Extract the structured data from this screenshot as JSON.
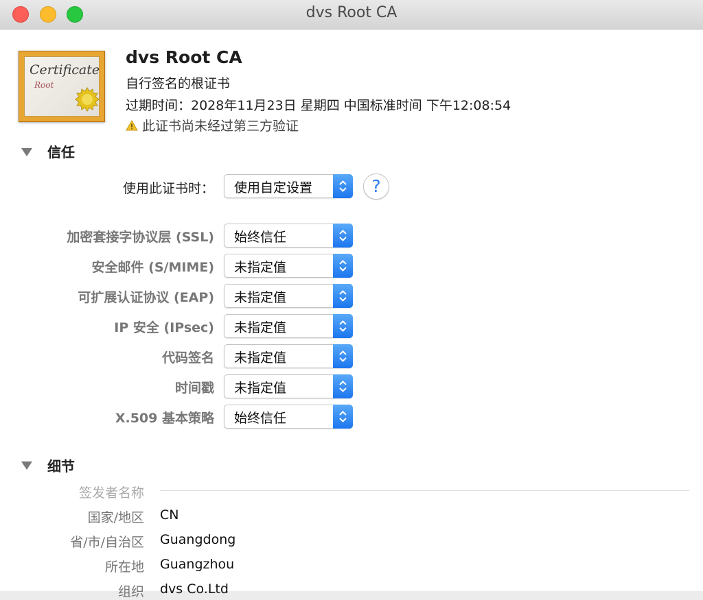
{
  "window": {
    "title": "dvs Root CA"
  },
  "certificate": {
    "icon_text": "Certificate",
    "icon_subtext": "Root",
    "name": "dvs Root CA",
    "kind": "自行签名的根证书",
    "expiry": "过期时间：2028年11月23日 星期四 中国标准时间 下午12:08:54",
    "warning": "此证书尚未经过第三方验证"
  },
  "trust": {
    "title": "信任",
    "use_label": "使用此证书时：",
    "use_value": "使用自定设置",
    "help_label": "?",
    "rows": [
      {
        "label": "加密套接字协议层 (SSL)",
        "value": "始终信任"
      },
      {
        "label": "安全邮件 (S/MIME)",
        "value": "未指定值"
      },
      {
        "label": "可扩展认证协议 (EAP)",
        "value": "未指定值"
      },
      {
        "label": "IP 安全 (IPsec)",
        "value": "未指定值"
      },
      {
        "label": "代码签名",
        "value": "未指定值"
      },
      {
        "label": "时间戳",
        "value": "未指定值"
      },
      {
        "label": "X.509 基本策略",
        "value": "始终信任"
      }
    ]
  },
  "details": {
    "title": "细节",
    "group_label": "签发者名称",
    "rows": [
      {
        "label": "国家/地区",
        "value": "CN"
      },
      {
        "label": "省/市/自治区",
        "value": "Guangdong"
      },
      {
        "label": "所在地",
        "value": "Guangzhou"
      },
      {
        "label": "组织",
        "value": "dvs Co.Ltd"
      }
    ]
  }
}
